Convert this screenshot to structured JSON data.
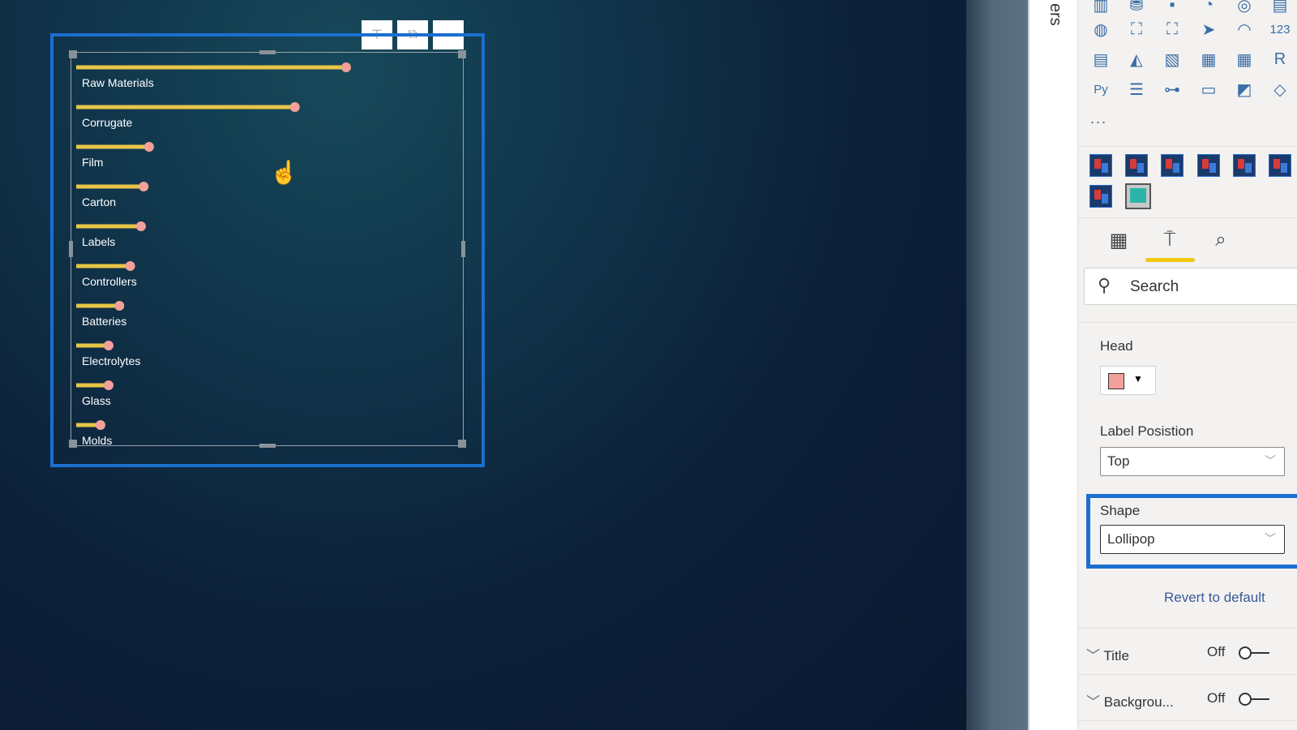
{
  "filters_pane": {
    "label": "ers"
  },
  "visual_header": {
    "filter_icon": "filter-icon",
    "focus_icon": "focus-mode-icon",
    "more_icon": "more-options-icon"
  },
  "visualizations": {
    "more_label": "...",
    "tabs": [
      {
        "name": "fields",
        "icon": "fields-grid-icon"
      },
      {
        "name": "format",
        "icon": "paint-roller-icon",
        "active": true
      },
      {
        "name": "analytics",
        "icon": "analytics-magnifier-icon"
      }
    ],
    "accent": "#f2c811"
  },
  "search": {
    "placeholder": "Search"
  },
  "format": {
    "head_label": "Head",
    "head_color": "#f4a09a",
    "label_position_label": "Label Posistion",
    "label_position_value": "Top",
    "shape_label": "Shape",
    "shape_value": "Lollipop",
    "revert_label": "Revert to default",
    "sections": [
      {
        "name": "Title",
        "state": "Off"
      },
      {
        "name": "Backgrou...",
        "state": "Off"
      }
    ]
  },
  "chart_data": {
    "type": "bar",
    "orientation": "horizontal",
    "shape": "lollipop",
    "label_position": "top",
    "categories": [
      "Raw Materials",
      "Corrugate",
      "Film",
      "Carton",
      "Labels",
      "Controllers",
      "Batteries",
      "Electrolytes",
      "Glass",
      "Molds"
    ],
    "values": [
      100,
      81,
      27,
      25,
      24,
      20,
      16,
      12,
      12,
      9
    ],
    "bar_color": "#e8c547",
    "head_color": "#f4a09a",
    "axis": "none",
    "grid": false
  }
}
